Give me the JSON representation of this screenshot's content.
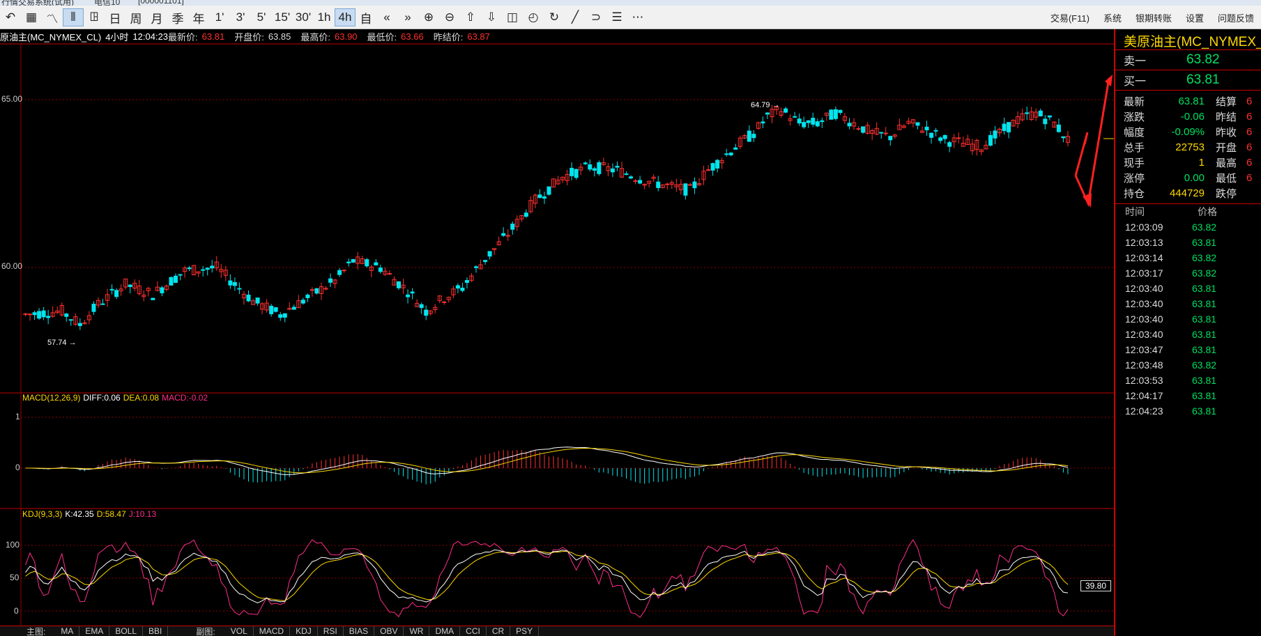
{
  "window": {
    "title": "行情交易系统(试用)",
    "server": "电信10",
    "account": "[000001101]"
  },
  "toolbar": {
    "left_buttons": [
      {
        "name": "back-icon",
        "label": "↶",
        "active": false
      },
      {
        "name": "grid-table-icon",
        "label": "▦",
        "active": false
      },
      {
        "name": "line-chart-icon",
        "label": "〽",
        "active": false
      },
      {
        "name": "candle-chart-icon",
        "label": "⫴",
        "active": true
      },
      {
        "name": "period-tick-button",
        "label": "ꖸ",
        "active": false
      },
      {
        "name": "period-day-button",
        "label": "日",
        "active": false
      },
      {
        "name": "period-week-button",
        "label": "周",
        "active": false
      },
      {
        "name": "period-month-button",
        "label": "月",
        "active": false
      },
      {
        "name": "period-season-button",
        "label": "季",
        "active": false
      },
      {
        "name": "period-year-button",
        "label": "年",
        "active": false
      },
      {
        "name": "period-1min-button",
        "label": "1'",
        "active": false
      },
      {
        "name": "period-3min-button",
        "label": "3'",
        "active": false
      },
      {
        "name": "period-5min-button",
        "label": "5'",
        "active": false
      },
      {
        "name": "period-15min-button",
        "label": "15'",
        "active": false
      },
      {
        "name": "period-30min-button",
        "label": "30'",
        "active": false
      },
      {
        "name": "period-1h-button",
        "label": "1h",
        "active": false
      },
      {
        "name": "period-4h-button",
        "label": "4h",
        "active": true
      },
      {
        "name": "period-custom-button",
        "label": "自",
        "active": false
      },
      {
        "name": "scroll-left-icon",
        "label": "«",
        "active": false
      },
      {
        "name": "scroll-right-icon",
        "label": "»",
        "active": false
      },
      {
        "name": "zoom-in-icon",
        "label": "⊕",
        "active": false
      },
      {
        "name": "zoom-out-icon",
        "label": "⊖",
        "active": false
      },
      {
        "name": "arrow-up-icon",
        "label": "⇧",
        "active": false
      },
      {
        "name": "arrow-down-icon",
        "label": "⇩",
        "active": false
      },
      {
        "name": "layout-icon",
        "label": "◫",
        "active": false
      },
      {
        "name": "speed-icon",
        "label": "◴",
        "active": false
      },
      {
        "name": "refresh-icon",
        "label": "↻",
        "active": false
      },
      {
        "name": "draw-line-icon",
        "label": "╱",
        "active": false
      },
      {
        "name": "curve-icon",
        "label": "⊃",
        "active": false
      },
      {
        "name": "list-icon",
        "label": "☰",
        "active": false
      },
      {
        "name": "more-icon",
        "label": "⋯",
        "active": false
      }
    ],
    "right_menu": [
      "交易(F11)",
      "系统",
      "银期转账",
      "设置",
      "问题反馈"
    ]
  },
  "infobar": {
    "symbol": "原油主(MC_NYMEX_CL)",
    "period": "4小时",
    "time": "12:04:23",
    "last_label": "最新价:",
    "last": "63.81",
    "open_label": "开盘价:",
    "open": "63.85",
    "high_label": "最高价:",
    "high": "63.90",
    "low_label": "最低价:",
    "low": "63.66",
    "prev_label": "昨结价:",
    "prev": "63.87"
  },
  "main_axis": {
    "upper": "65.00",
    "lower": "60.00"
  },
  "annotations": {
    "high_marker": "64.79",
    "low_marker": "57.74"
  },
  "macd": {
    "title": "MACD(12,26,9)",
    "diff_label": "DIFF:",
    "diff": "0.06",
    "dea_label": "DEA:",
    "dea": "0.08",
    "macd_label": "MACD:",
    "macd": "-0.02",
    "axis": [
      "1",
      "0"
    ]
  },
  "kdj": {
    "title": "KDJ(9,3,3)",
    "k_label": "K:",
    "k": "42.35",
    "d_label": "D:",
    "d": "58.47",
    "j_label": "J:",
    "j": "10.13",
    "axis": [
      "100",
      "50",
      "0"
    ],
    "current_value": "39.80"
  },
  "colors": {
    "up": "#ff3030",
    "down": "#00e5ee",
    "grid": "#8b0000",
    "diff": "#ffffff",
    "dea": "#ffd900",
    "j_line": "#ff2d8a"
  },
  "right_panel": {
    "title": "美原油主(MC_NYMEX_CL)",
    "ask_label": "卖一",
    "ask": "63.82",
    "bid_label": "买一",
    "bid": "63.81",
    "stats": [
      {
        "k1": "最新",
        "v1": "63.81",
        "c1": "green",
        "k2": "结算",
        "v2": "6"
      },
      {
        "k1": "涨跌",
        "v1": "-0.06",
        "c1": "green",
        "k2": "昨结",
        "v2": "6"
      },
      {
        "k1": "幅度",
        "v1": "-0.09%",
        "c1": "green",
        "k2": "昨收",
        "v2": "6"
      },
      {
        "k1": "总手",
        "v1": "22753",
        "c1": "yellow",
        "k2": "开盘",
        "v2": "6"
      },
      {
        "k1": "现手",
        "v1": "1",
        "c1": "yellow",
        "k2": "最高",
        "v2": "6"
      },
      {
        "k1": "涨停",
        "v1": "0.00",
        "c1": "green",
        "k2": "最低",
        "v2": "6"
      },
      {
        "k1": "持仓",
        "v1": "444729",
        "c1": "yellow",
        "k2": "跌停",
        "v2": ""
      }
    ],
    "ticks_header": {
      "time": "时间",
      "price": "价格"
    },
    "ticks": [
      {
        "time": "12:03:09",
        "price": "63.82"
      },
      {
        "time": "12:03:13",
        "price": "63.81"
      },
      {
        "time": "12:03:14",
        "price": "63.82"
      },
      {
        "time": "12:03:17",
        "price": "63.82"
      },
      {
        "time": "12:03:40",
        "price": "63.81"
      },
      {
        "time": "12:03:40",
        "price": "63.81"
      },
      {
        "time": "12:03:40",
        "price": "63.81"
      },
      {
        "time": "12:03:40",
        "price": "63.81"
      },
      {
        "time": "12:03:47",
        "price": "63.81"
      },
      {
        "time": "12:03:48",
        "price": "63.82"
      },
      {
        "time": "12:03:53",
        "price": "63.81"
      },
      {
        "time": "12:04:17",
        "price": "63.81"
      },
      {
        "time": "12:04:23",
        "price": "63.81"
      }
    ]
  },
  "bottom_tabs": {
    "main_label": "主图:",
    "main": [
      "MA",
      "EMA",
      "BOLL",
      "BBI"
    ],
    "sub_label": "副图:",
    "sub": [
      "VOL",
      "MACD",
      "KDJ",
      "RSI",
      "BIAS",
      "OBV",
      "WR",
      "DMA",
      "CCI",
      "CR",
      "PSY"
    ]
  }
}
